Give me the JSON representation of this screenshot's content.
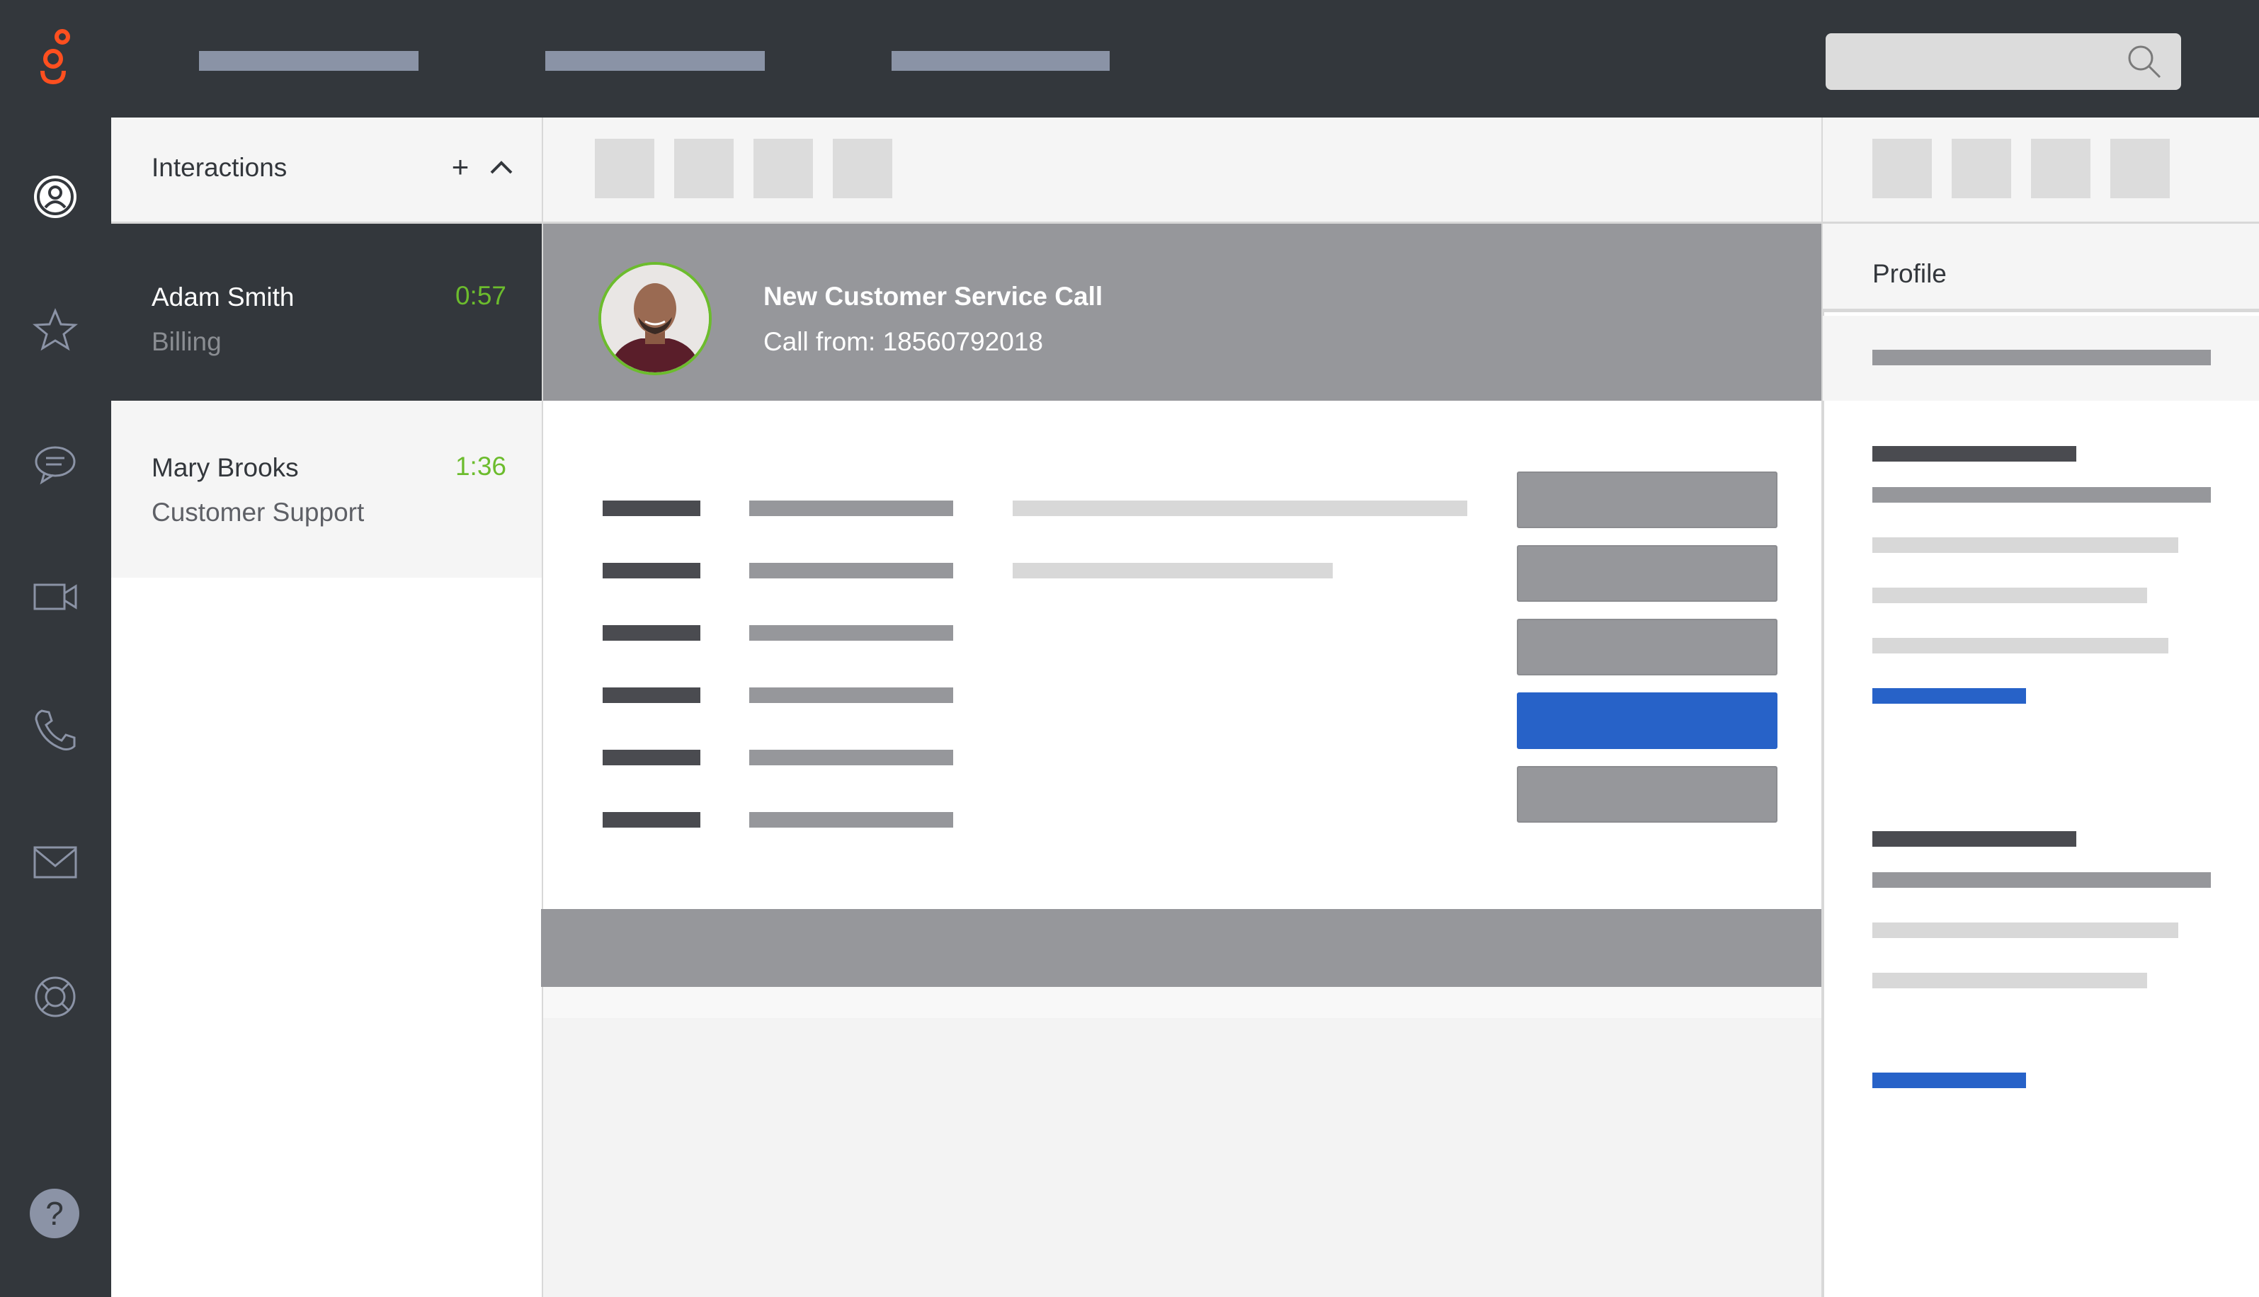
{
  "interactions": {
    "header_label": "Interactions",
    "add_label": "+",
    "items": [
      {
        "name": "Adam Smith",
        "queue": "Billing",
        "time": "0:57"
      },
      {
        "name": "Mary Brooks",
        "queue": "Customer Support",
        "time": "1:36"
      }
    ]
  },
  "call": {
    "title": "New Customer Service Call",
    "subtitle": "Call from: 18560792018"
  },
  "profile": {
    "tab_label": "Profile"
  },
  "help": {
    "label": "?"
  },
  "colors": {
    "topbar": "#33373c",
    "accent_brand": "#ff4f1f",
    "timer_green": "#6cbc2d",
    "primary_blue": "#2762c8",
    "banner_gray": "#96979b"
  },
  "icons": [
    "brand-logo-icon",
    "search-icon",
    "user-profile-icon",
    "star-icon",
    "chat-icon",
    "video-icon",
    "phone-icon",
    "mail-icon",
    "lifebuoy-icon",
    "help-icon",
    "plus-icon",
    "chevron-up-icon"
  ]
}
